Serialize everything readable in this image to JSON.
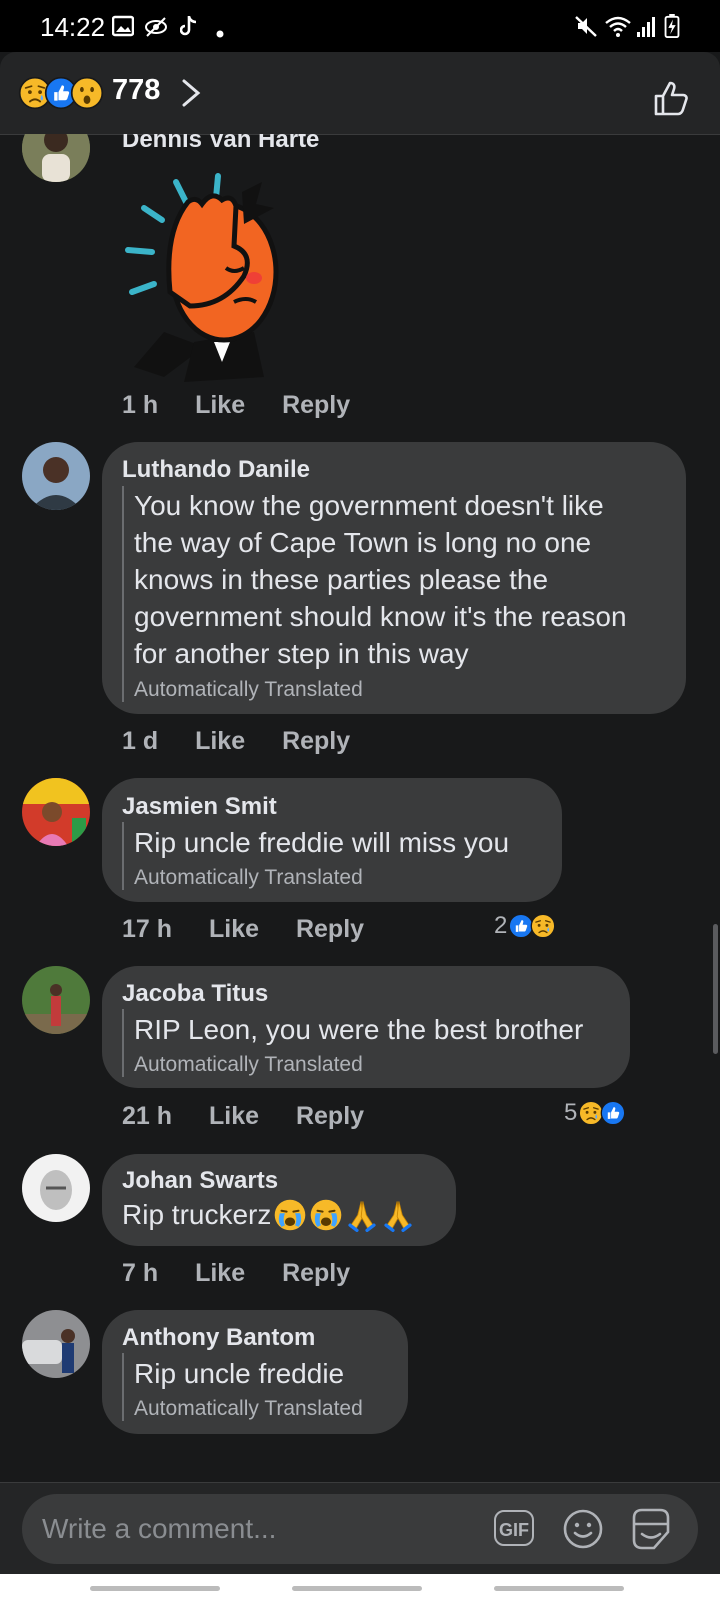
{
  "status_bar": {
    "time": "14:22"
  },
  "reactions_header": {
    "count": "778",
    "icons": [
      "sad-reaction-icon",
      "like-reaction-icon",
      "wow-reaction-icon"
    ]
  },
  "comments": [
    {
      "author": "Dennis Van Harte",
      "sticker": "facepalm-sticker",
      "time": "1 h",
      "like": "Like",
      "reply": "Reply"
    },
    {
      "author": "Luthando Danile",
      "text": "You know the government doesn't like\nthe way of Cape Town is long no one\nknows in these parties please the\ngovernment should know it's the reason\nfor another step in this way",
      "translated": "Automatically Translated",
      "time": "1 d",
      "like": "Like",
      "reply": "Reply"
    },
    {
      "author": "Jasmien Smit",
      "text": "Rip uncle freddie will miss you",
      "translated": "Automatically Translated",
      "time": "17 h",
      "like": "Like",
      "reply": "Reply",
      "reaction_count": "2",
      "reaction_icons": [
        "like-reaction-icon",
        "sad-reaction-icon"
      ]
    },
    {
      "author": "Jacoba Titus",
      "text": "RIP Leon, you were the best brother",
      "translated": "Automatically Translated",
      "time": "21 h",
      "like": "Like",
      "reply": "Reply",
      "reaction_count": "5",
      "reaction_icons": [
        "sad-reaction-icon",
        "like-reaction-icon"
      ]
    },
    {
      "author": "Johan Swarts",
      "text": "Rip truckerz",
      "emojis": [
        "crying-face",
        "crying-face",
        "folded-hands",
        "folded-hands"
      ],
      "time": "7 h",
      "like": "Like",
      "reply": "Reply"
    },
    {
      "author": "Anthony Bantom",
      "text": "Rip uncle freddie",
      "translated": "Automatically Translated"
    }
  ],
  "composer": {
    "placeholder": "Write a comment...",
    "gif_label": "GIF"
  },
  "colors": {
    "background": "#18191a",
    "bubble": "#3a3b3c",
    "text": "#e4e6eb",
    "muted": "#b0b3b8",
    "like_blue": "#1877f2",
    "sad_yellow": "#f7b928",
    "sticker_orange": "#f26522"
  }
}
